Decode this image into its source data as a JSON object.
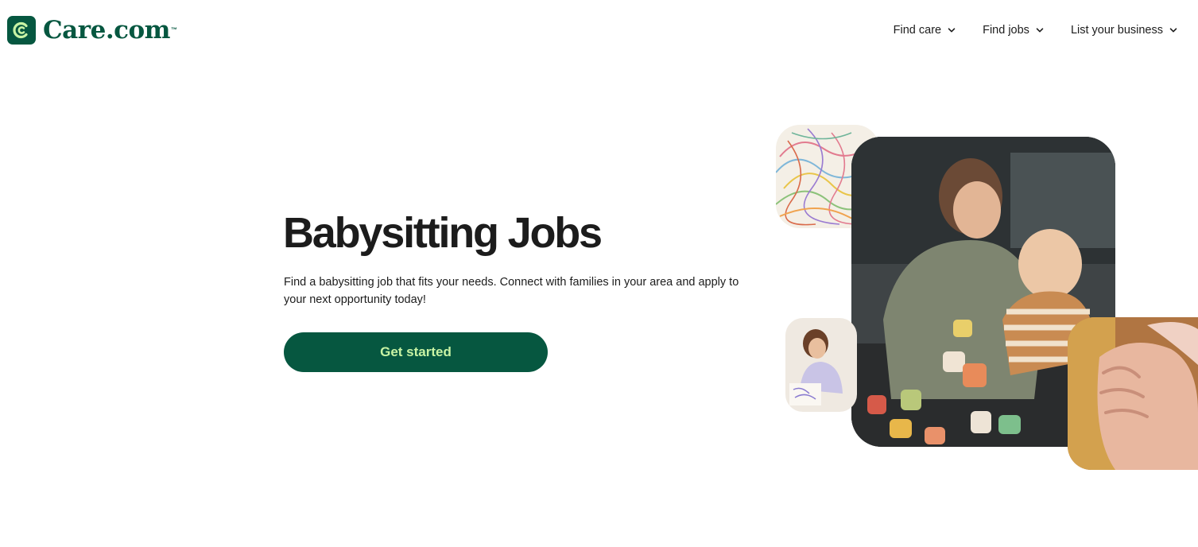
{
  "header": {
    "logo": {
      "text": "Care.com",
      "tm": "™",
      "icon": "care-logo-icon"
    },
    "nav": [
      {
        "label": "Find care",
        "icon": "chevron-down-icon"
      },
      {
        "label": "Find jobs",
        "icon": "chevron-down-icon"
      },
      {
        "label": "List your business",
        "icon": "chevron-down-icon"
      }
    ]
  },
  "hero": {
    "title": "Babysitting Jobs",
    "description": "Find a babysitting job that fits your needs. Connect with families in your area and apply to your next opportunity today!",
    "cta_label": "Get started"
  },
  "images": [
    {
      "name": "crayon-scribble-photo"
    },
    {
      "name": "mother-and-baby-playing-photo"
    },
    {
      "name": "girl-drawing-photo"
    },
    {
      "name": "holding-hands-photo"
    }
  ],
  "colors": {
    "brand": "#065740",
    "cta_text": "#c8f3a4",
    "text": "#1c1c1c",
    "background": "#ffffff"
  }
}
